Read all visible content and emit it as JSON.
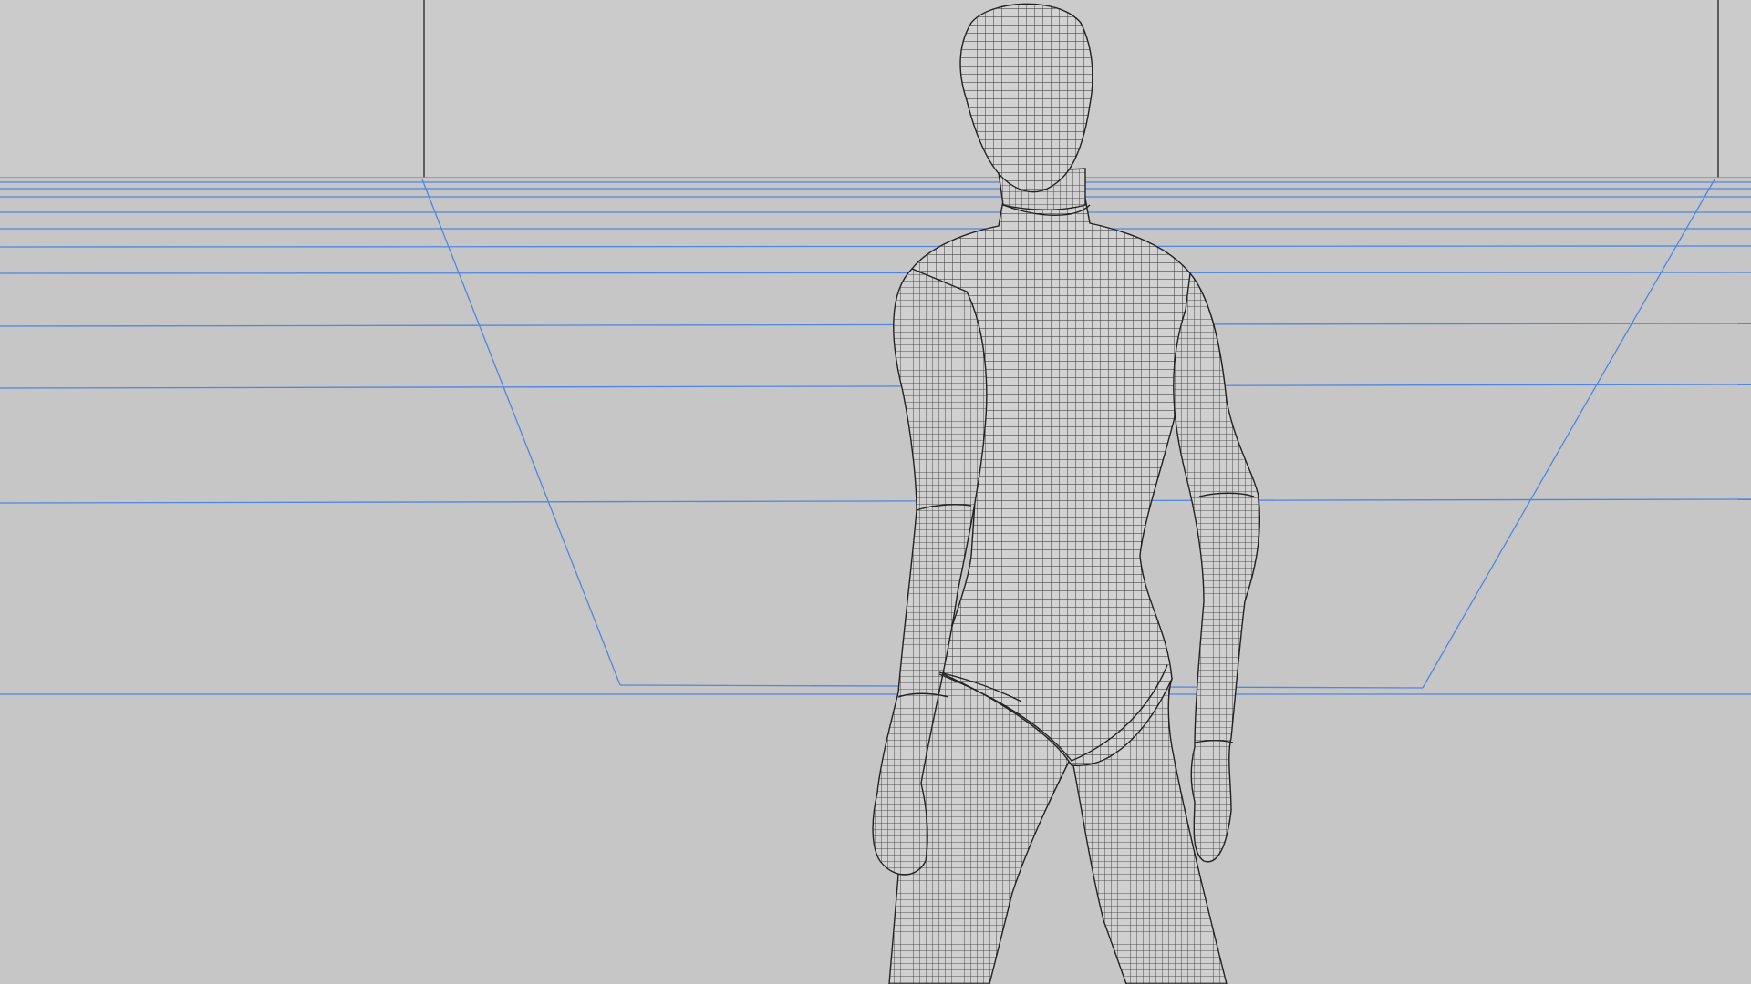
{
  "scene": {
    "background_color": "#c8c8c8",
    "wall_color": "#cbcbcb",
    "floor_color": "#c6c6c6",
    "grid_line_color": "#4f86e0",
    "edge_line_color": "#3a3a3a",
    "mesh_line_color": "#2b2b2b",
    "mesh_fill_color": "#cfcfcf",
    "subject": "wireframe-human-figure",
    "view": "back-view"
  }
}
